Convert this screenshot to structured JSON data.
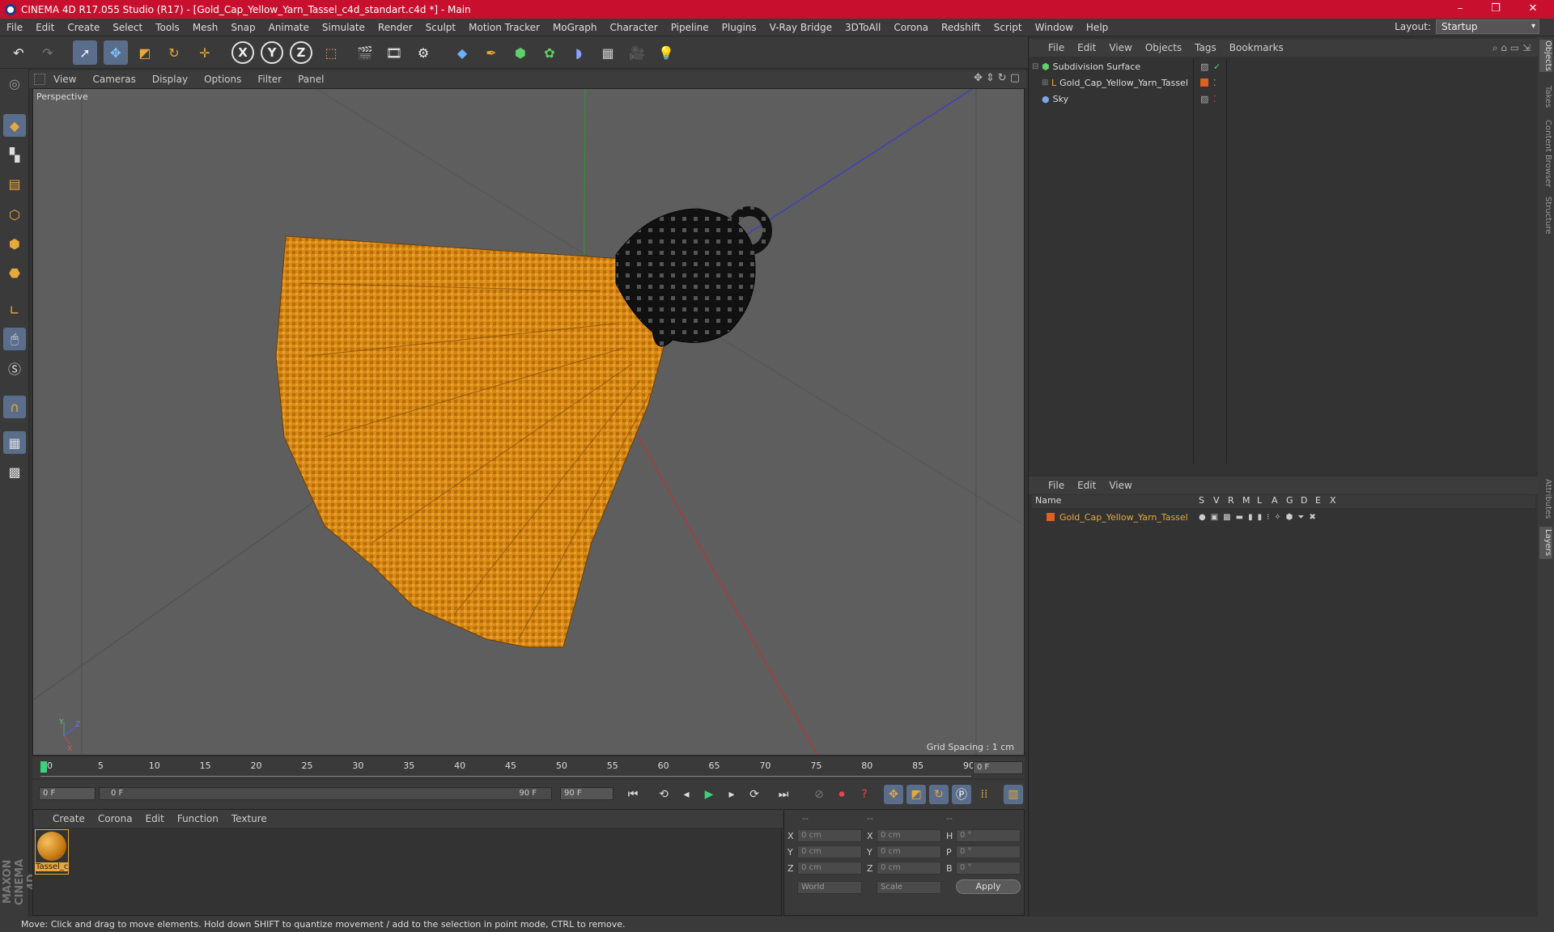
{
  "title_bar": {
    "title": "CINEMA 4D R17.055 Studio (R17) - [Gold_Cap_Yellow_Yarn_Tassel_c4d_standart.c4d *] - Main",
    "controls": [
      "–",
      "❐",
      "✕"
    ]
  },
  "menu": [
    "File",
    "Edit",
    "Create",
    "Select",
    "Tools",
    "Mesh",
    "Snap",
    "Animate",
    "Simulate",
    "Render",
    "Sculpt",
    "Motion Tracker",
    "MoGraph",
    "Character",
    "Pipeline",
    "Plugins",
    "V-Ray Bridge",
    "3DToAll",
    "Corona",
    "Redshift",
    "Script",
    "Window",
    "Help"
  ],
  "layout": {
    "label": "Layout:",
    "value": "Startup"
  },
  "viewport": {
    "menu": [
      "View",
      "Cameras",
      "Display",
      "Options",
      "Filter",
      "Panel"
    ],
    "label": "Perspective",
    "grid_spacing": "Grid Spacing : 1 cm",
    "axes": {
      "x": "X",
      "y": "Y",
      "z": "Z"
    }
  },
  "timeline": {
    "ticks": [
      "0",
      "5",
      "10",
      "15",
      "20",
      "25",
      "30",
      "35",
      "40",
      "45",
      "50",
      "55",
      "60",
      "65",
      "70",
      "75",
      "80",
      "85",
      "90"
    ],
    "current_frame": "0 F",
    "start_field": "0 F",
    "range_start": "0 F",
    "range_end": "90 F",
    "end_field": "90 F"
  },
  "material_panel": {
    "menu": [
      "Create",
      "Corona",
      "Edit",
      "Function",
      "Texture"
    ],
    "material_name": "Tassel_c"
  },
  "coord_panel": {
    "header": [
      "--",
      "--",
      "--"
    ],
    "rows": [
      {
        "l1": "X",
        "v1": "0 cm",
        "l2": "X",
        "v2": "0 cm",
        "l3": "H",
        "v3": "0 °"
      },
      {
        "l1": "Y",
        "v1": "0 cm",
        "l2": "Y",
        "v2": "0 cm",
        "l3": "P",
        "v3": "0 °"
      },
      {
        "l1": "Z",
        "v1": "0 cm",
        "l2": "Z",
        "v2": "0 cm",
        "l3": "B",
        "v3": "0 °"
      }
    ],
    "world": "World",
    "scale": "Scale",
    "apply": "Apply"
  },
  "object_manager": {
    "menu": [
      "File",
      "Edit",
      "View",
      "Objects",
      "Tags",
      "Bookmarks"
    ],
    "objects": [
      {
        "name": "Subdivision Surface"
      },
      {
        "name": "Gold_Cap_Yellow_Yarn_Tassel"
      },
      {
        "name": "Sky"
      }
    ]
  },
  "layer_manager": {
    "menu": [
      "File",
      "Edit",
      "View"
    ],
    "columns": [
      "Name",
      "S",
      "V",
      "R",
      "M",
      "L",
      "A",
      "G",
      "D",
      "E",
      "X"
    ],
    "layer": "Gold_Cap_Yellow_Yarn_Tassel"
  },
  "right_tabs": [
    "Objects",
    "Takes",
    "Content Browser",
    "Structure",
    "Attributes",
    "Layers"
  ],
  "branding": "MAXON CINEMA 4D",
  "status": "Move: Click and drag to move elements. Hold down SHIFT to quantize movement / add to the selection in point mode, CTRL to remove.",
  "colors": {
    "title_bar": "#c8102e",
    "tassel": "#d98a12",
    "cap": "#111111",
    "accent": "#e8a83a"
  }
}
